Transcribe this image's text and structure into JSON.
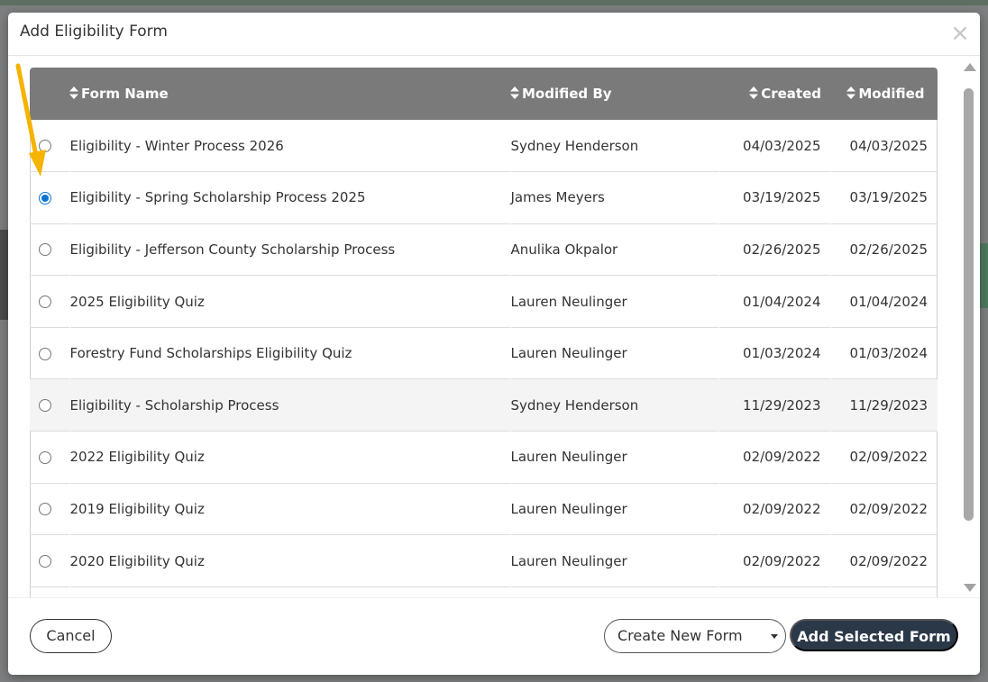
{
  "modal": {
    "title": "Add Eligibility Form",
    "close_label": "×"
  },
  "table": {
    "columns": {
      "form_name": "Form Name",
      "modified_by": "Modified By",
      "created": "Created",
      "modified": "Modified"
    },
    "rows": [
      {
        "name": "Eligibility - Winter Process 2026",
        "modified_by": "Sydney Henderson",
        "created": "04/03/2025",
        "modified": "04/03/2025",
        "selected": false,
        "highlighted": false
      },
      {
        "name": "Eligibility - Spring Scholarship Process 2025",
        "modified_by": "James Meyers",
        "created": "03/19/2025",
        "modified": "03/19/2025",
        "selected": true,
        "highlighted": false
      },
      {
        "name": "Eligibility - Jefferson County Scholarship Process",
        "modified_by": "Anulika Okpalor",
        "created": "02/26/2025",
        "modified": "02/26/2025",
        "selected": false,
        "highlighted": false
      },
      {
        "name": "2025 Eligibility Quiz",
        "modified_by": "Lauren Neulinger",
        "created": "01/04/2024",
        "modified": "01/04/2024",
        "selected": false,
        "highlighted": false
      },
      {
        "name": "Forestry Fund Scholarships Eligibility Quiz",
        "modified_by": "Lauren Neulinger",
        "created": "01/03/2024",
        "modified": "01/03/2024",
        "selected": false,
        "highlighted": false
      },
      {
        "name": "Eligibility - Scholarship Process",
        "modified_by": "Sydney Henderson",
        "created": "11/29/2023",
        "modified": "11/29/2023",
        "selected": false,
        "highlighted": true
      },
      {
        "name": "2022 Eligibility Quiz",
        "modified_by": "Lauren Neulinger",
        "created": "02/09/2022",
        "modified": "02/09/2022",
        "selected": false,
        "highlighted": false
      },
      {
        "name": "2019 Eligibility Quiz",
        "modified_by": "Lauren Neulinger",
        "created": "02/09/2022",
        "modified": "02/09/2022",
        "selected": false,
        "highlighted": false
      },
      {
        "name": "2020 Eligibility Quiz",
        "modified_by": "Lauren Neulinger",
        "created": "02/09/2022",
        "modified": "02/09/2022",
        "selected": false,
        "highlighted": false
      }
    ]
  },
  "footer": {
    "cancel_label": "Cancel",
    "create_label": "Create New Form",
    "add_label": "Add Selected Form"
  },
  "colors": {
    "header_bg": "#7a7a7a",
    "radio_selected": "#0b75d1",
    "primary_button": "#2b3848",
    "annotation_arrow": "#f5b400"
  }
}
